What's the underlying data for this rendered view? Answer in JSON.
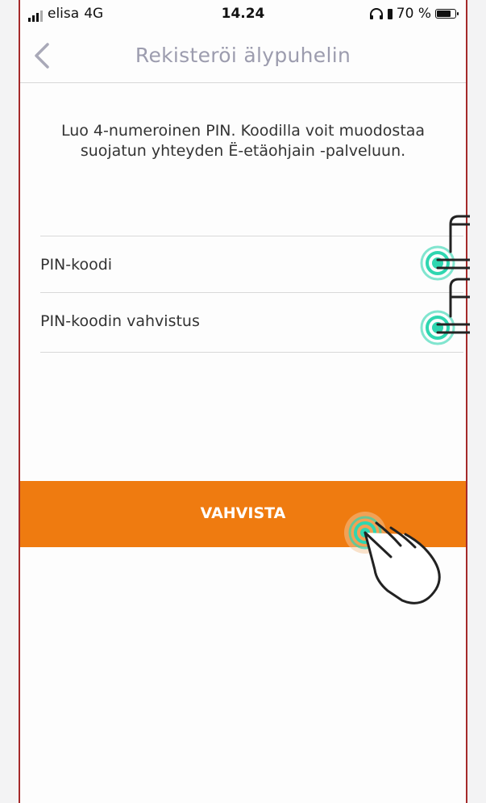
{
  "status_bar": {
    "carrier": "elisa",
    "network": "4G",
    "time": "14.24",
    "battery_text": "70 %"
  },
  "nav": {
    "back_icon": "chevron-left-icon",
    "title": "Rekisteröi älypuhelin"
  },
  "intro_text": "Luo 4-numeroinen PIN. Koodilla voit muodostaa suojatun yhteyden Ë-etäohjain -palveluun.",
  "form": {
    "pin_label": "PIN-koodi",
    "pin_confirm_label": "PIN-koodin vahvistus"
  },
  "confirm_button": "VAHVISTA",
  "colors": {
    "accent": "#ef7b10",
    "title": "#9c9cae",
    "frame_border": "#a52a2a",
    "tap_hint": "#2fd6b0"
  }
}
